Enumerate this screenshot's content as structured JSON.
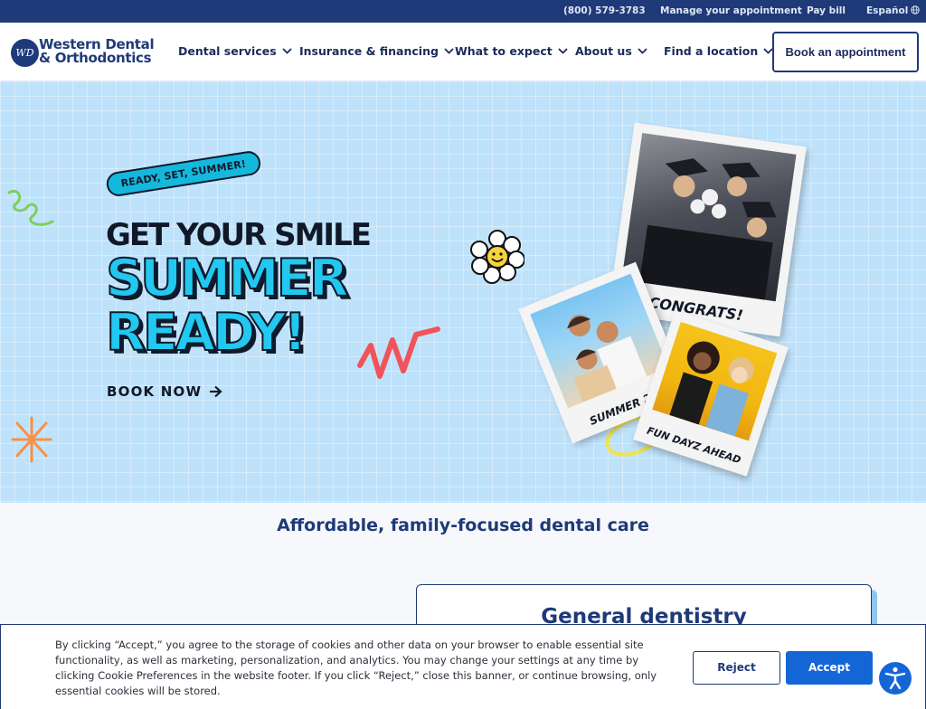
{
  "topbar": {
    "phone": "(800) 579-3783",
    "manage": "Manage your appointment",
    "pay": "Pay bill",
    "language": "Español"
  },
  "nav": {
    "logo_line1": "Western Dental",
    "logo_line2": "& Orthodontics",
    "logo_mark": "WD",
    "items": [
      {
        "label": "Dental services"
      },
      {
        "label": "Insurance & financing"
      },
      {
        "label": "What to expect"
      },
      {
        "label": "About us"
      },
      {
        "label": "Find a location"
      }
    ],
    "cta": "Book an appointment"
  },
  "hero": {
    "tag": "READY, SET, SUMMER!",
    "line1": "GET YOUR SMILE",
    "line2": "SUMMER",
    "line3": "READY!",
    "cta": "BOOK NOW",
    "photos": [
      {
        "caption": "CONGRATS!"
      },
      {
        "caption": "SUMMER 26!"
      },
      {
        "caption": "FUN DAYZ AHEAD"
      }
    ]
  },
  "section": {
    "title": "Affordable, family-focused dental care",
    "card_title": "General dentistry"
  },
  "cookie": {
    "text": "By clicking “Accept,” you agree to the storage of cookies and other data on your browser to enable essential site functionality, as well as marketing, personalization, and analytics. You may change your settings at any time by clicking Cookie Preferences in the website footer. If you click “Reject,” close this banner, or continue browsing, only essential cookies will be stored.",
    "reject": "Reject",
    "accept": "Accept"
  },
  "colors": {
    "brand_navy": "#1f3a78",
    "hero_bg": "#bfe2fb",
    "accent_cyan": "#22c8ef",
    "accept_blue": "#1466d6"
  },
  "icons": [
    "globe-icon",
    "chevron-down-icon",
    "arrow-right-icon",
    "accessibility-icon",
    "smiley-flower-icon"
  ]
}
